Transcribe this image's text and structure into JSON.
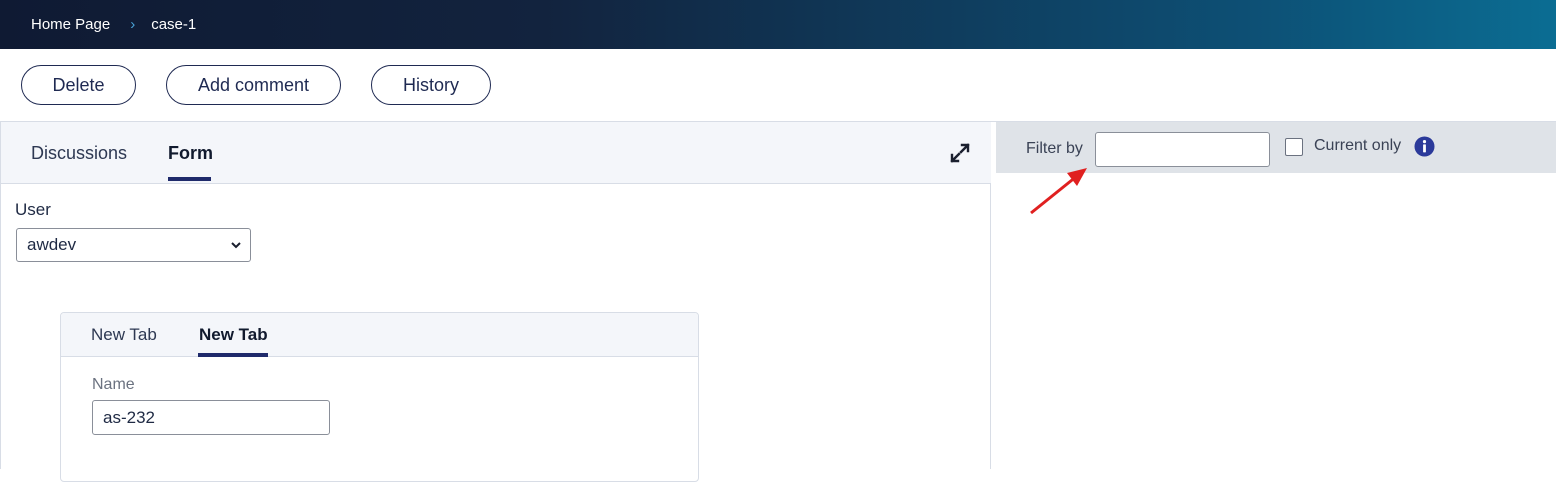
{
  "breadcrumb": {
    "home": "Home Page",
    "separator": "›",
    "current": "case-1"
  },
  "toolbar": {
    "delete_label": "Delete",
    "add_comment_label": "Add comment",
    "history_label": "History"
  },
  "left_panel": {
    "tabs": [
      {
        "label": "Discussions",
        "active": false
      },
      {
        "label": "Form",
        "active": true
      }
    ],
    "form": {
      "user_label": "User",
      "user_value": "awdev",
      "subtabs": [
        {
          "label": "New Tab",
          "active": false
        },
        {
          "label": "New Tab",
          "active": true
        }
      ],
      "name_label": "Name",
      "name_value": "as-232"
    }
  },
  "right_panel": {
    "filter_label": "Filter by",
    "filter_value": "",
    "current_only_label": "Current only",
    "current_only_checked": false
  },
  "colors": {
    "accent": "#1f2a6b",
    "info": "#2b3a9a",
    "annotation_arrow": "#e02020"
  }
}
